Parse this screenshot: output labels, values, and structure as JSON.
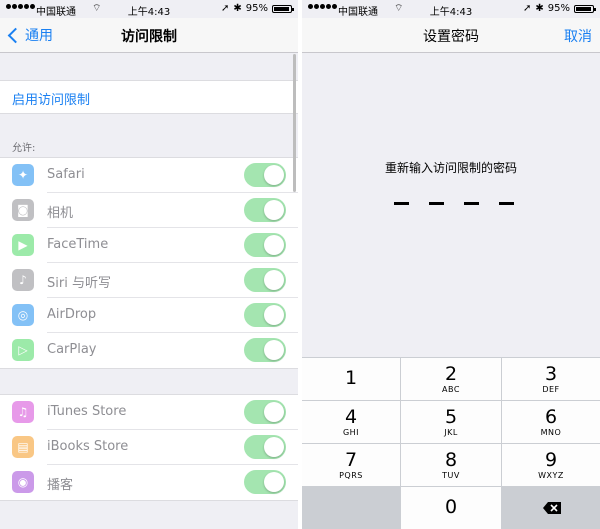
{
  "status": {
    "carrier": "中国联通",
    "time": "上午4:43",
    "battery": "95%"
  },
  "left": {
    "back_label": "通用",
    "title": "访问限制",
    "enable_label": "启用访问限制",
    "allow_label": "允许:",
    "group1": [
      {
        "label": "Safari",
        "icon": "safari-icon",
        "color": "#1e8ff0",
        "on": true
      },
      {
        "label": "相机",
        "icon": "camera-icon",
        "color": "#8e8e93",
        "on": true
      },
      {
        "label": "FaceTime",
        "icon": "facetime-icon",
        "color": "#4cd964",
        "on": true
      },
      {
        "label": "Siri 与听写",
        "icon": "microphone-icon",
        "color": "#8e8e93",
        "on": true
      },
      {
        "label": "AirDrop",
        "icon": "airdrop-icon",
        "color": "#1e8ff0",
        "on": true
      },
      {
        "label": "CarPlay",
        "icon": "carplay-icon",
        "color": "#4cd964",
        "on": true
      }
    ],
    "group2": [
      {
        "label": "iTunes Store",
        "icon": "itunes-icon",
        "color": "#d448d8",
        "on": true
      },
      {
        "label": "iBooks Store",
        "icon": "ibooks-icon",
        "color": "#f59a23",
        "on": true
      },
      {
        "label": "播客",
        "icon": "podcast-icon",
        "color": "#a248d8",
        "on": true
      }
    ]
  },
  "right": {
    "title": "设置密码",
    "cancel_label": "取消",
    "prompt": "重新输入访问限制的密码",
    "keys": [
      {
        "num": "1",
        "letters": ""
      },
      {
        "num": "2",
        "letters": "ABC"
      },
      {
        "num": "3",
        "letters": "DEF"
      },
      {
        "num": "4",
        "letters": "GHI"
      },
      {
        "num": "5",
        "letters": "JKL"
      },
      {
        "num": "6",
        "letters": "MNO"
      },
      {
        "num": "7",
        "letters": "PQRS"
      },
      {
        "num": "8",
        "letters": "TUV"
      },
      {
        "num": "9",
        "letters": "WXYZ"
      },
      {
        "num": "0",
        "letters": ""
      }
    ]
  }
}
